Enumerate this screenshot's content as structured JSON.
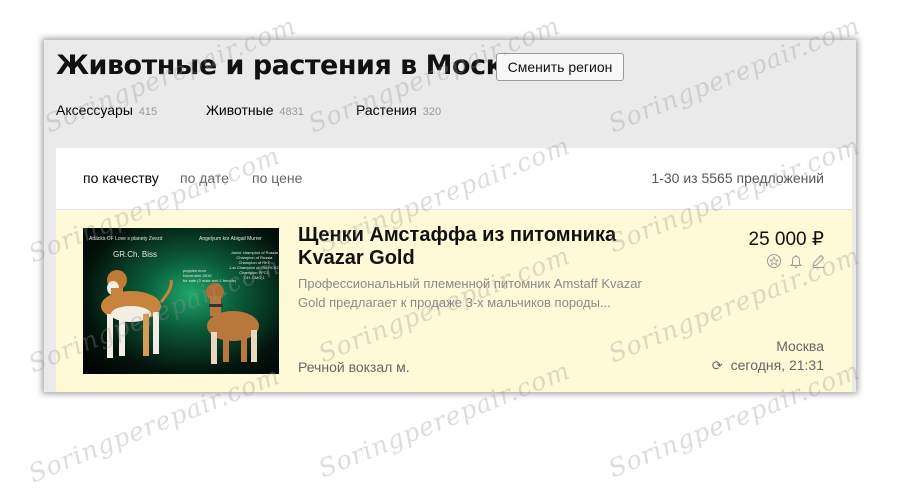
{
  "header": {
    "title": "Животные и растения в Москве",
    "region_button": "Сменить регион"
  },
  "categories": [
    {
      "label": "Аксессуары",
      "count": "415"
    },
    {
      "label": "Животные",
      "count": "4831"
    },
    {
      "label": "Растения",
      "count": "320"
    }
  ],
  "sort": {
    "options": [
      "по качеству",
      "по дате",
      "по цене"
    ],
    "active": "по качеству",
    "total": "1-30 из 5565 предложений"
  },
  "listing": {
    "title": "Щенки Амстаффа из питомника Kvazar Gold",
    "description": "Профессиональный племенной питомник Amstaff Kvazar Gold предлагает к продаже 3-х мальчиков породы...",
    "metro": "Речной вокзал м.",
    "price": "25 000 ₽",
    "city": "Москва",
    "date": "сегодня, 21:31",
    "image_captions": {
      "left_top": "Attacks  OF Love s planety Zvezd",
      "right_top": "Angelyum kor  Abigail Murrer",
      "badge": "GR.Ch. Biss",
      "champ_lines": "Junior champion of Russia\nChampion of Russia\nChampion of RKF\n1-st Champion of Ost-RCKO\nChampion PFCC\nCH. CMO 1",
      "puppy_note": "puppies born\nNovember 2016\nfor sale (3 male and 1 female)"
    }
  },
  "icons": [
    "star-icon",
    "bell-icon",
    "pencil-icon",
    "refresh-icon"
  ],
  "watermark": "Soringperepair.com",
  "colors": {
    "frame_bg": "#eaeaea",
    "card_highlight": "#fef9d6",
    "muted_text": "#8a8a8a"
  }
}
